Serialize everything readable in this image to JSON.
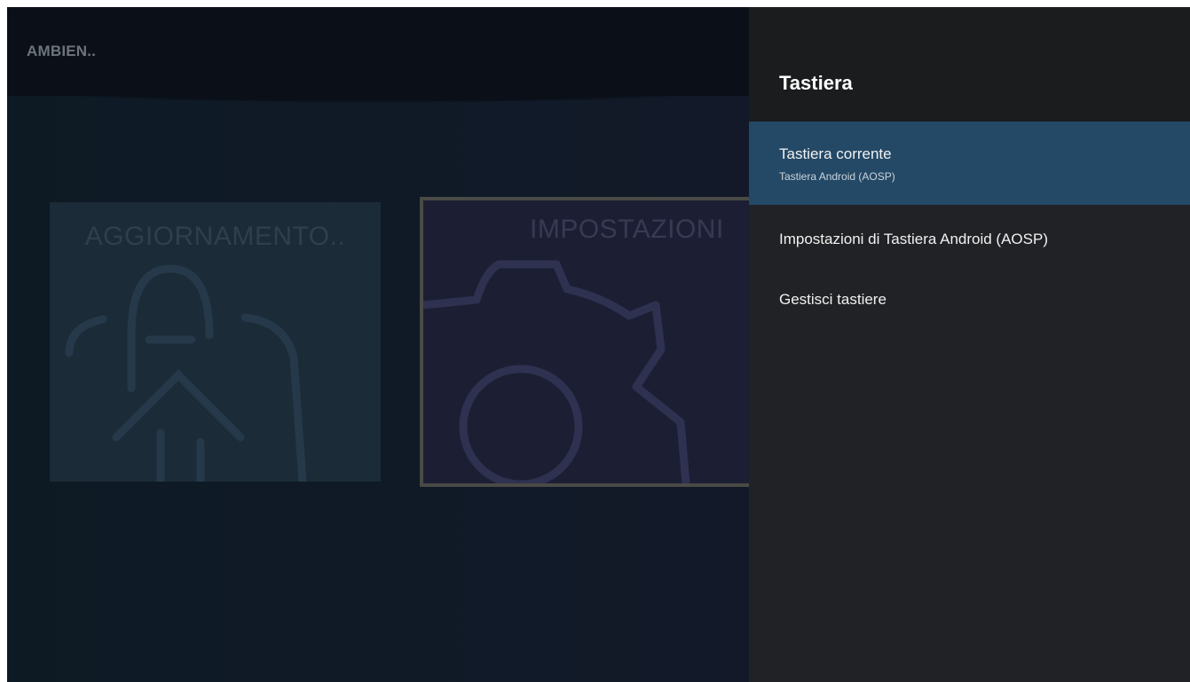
{
  "background_app": {
    "title": "AMBIEN..",
    "tiles": [
      {
        "label": "AGGIORNAMENTO..",
        "icon": "update-bag-icon"
      },
      {
        "label": "IMPOSTAZIONI",
        "icon": "gear-icon"
      }
    ]
  },
  "panel": {
    "title": "Tastiera",
    "items": [
      {
        "label": "Tastiera corrente",
        "sublabel": "Tastiera Android (AOSP)",
        "selected": true
      },
      {
        "label": "Impostazioni di Tastiera Android (AOSP)"
      },
      {
        "label": "Gestisci tastiere"
      }
    ]
  },
  "colors": {
    "panel_bg": "#212225",
    "panel_header_bg": "#1b1c1e",
    "selected_item_bg": "#244966"
  }
}
